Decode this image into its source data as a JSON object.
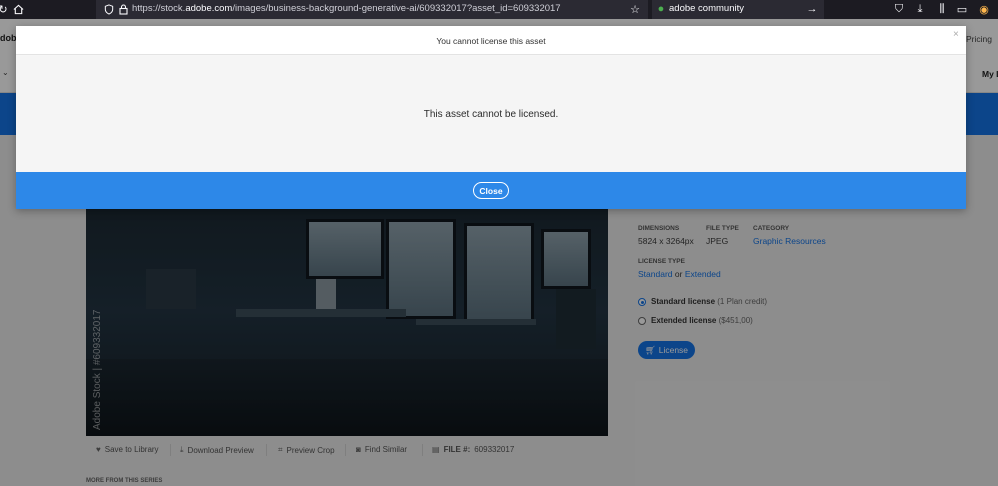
{
  "browser": {
    "url_prefix": "https://stock.",
    "url_domain": "adobe.com",
    "url_suffix": "/images/business-background-generative-ai/609332017?asset_id=609332017",
    "search_text": "adobe community"
  },
  "header": {
    "logo_text": "dobe",
    "pricing_label": "Pricing",
    "my_library_label": "My L"
  },
  "asset": {
    "watermark": "Adobe Stock | #609332017",
    "dimensions_label": "DIMENSIONS",
    "dimensions_value": "5824 x 3264px",
    "file_type_label": "FILE TYPE",
    "file_type_value": "JPEG",
    "category_label": "CATEGORY",
    "category_value": "Graphic Resources",
    "license_type_label": "LICENSE TYPE",
    "license_standard": "Standard",
    "license_or": "or",
    "license_extended": "Extended",
    "standard_license_label": "Standard license",
    "standard_license_sub": "(1 Plan credit)",
    "extended_license_label": "Extended license",
    "extended_license_sub": "($451,00)",
    "license_button": "License"
  },
  "actions": {
    "save_to_library": "Save to Library",
    "download_preview": "Download Preview",
    "preview_crop": "Preview Crop",
    "find_similar": "Find Similar",
    "file_label": "FILE #:",
    "file_number": "609332017"
  },
  "more_from_series": "MORE FROM THIS SERIES",
  "modal": {
    "title": "You cannot license this asset",
    "message": "This asset cannot be licensed.",
    "close_button": "Close",
    "close_x": "×"
  }
}
